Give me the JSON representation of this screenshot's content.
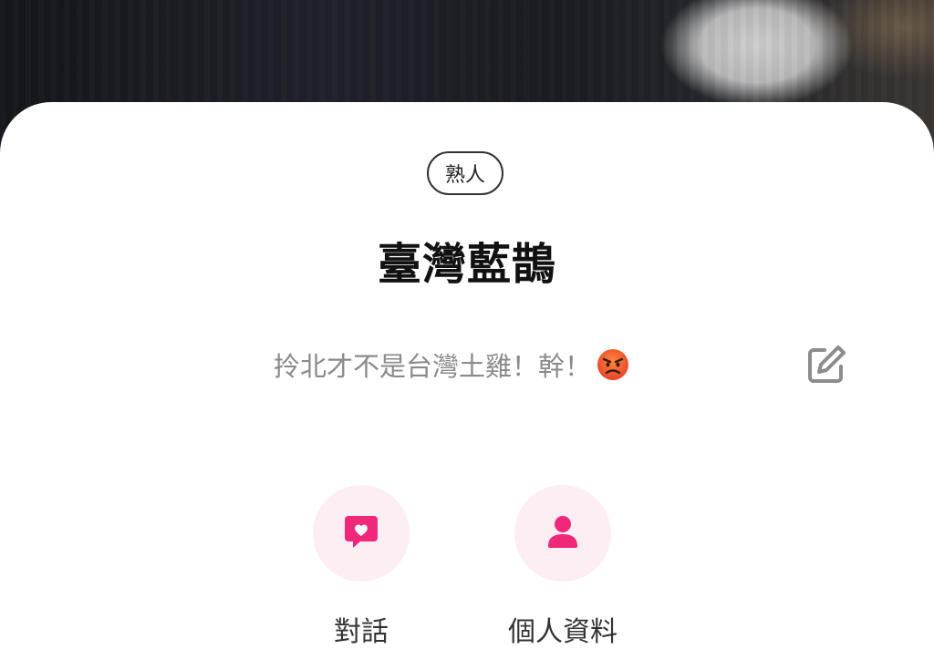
{
  "profile": {
    "relation_badge": "熟人",
    "name": "臺灣藍鵲",
    "status_text": "拎北才不是台灣土雞！幹！",
    "status_emoji": "angry-face-emoji"
  },
  "actions": [
    {
      "label": "對話",
      "icon": "chat-heart-icon"
    },
    {
      "label": "個人資料",
      "icon": "person-icon"
    }
  ],
  "edit_icon": "edit-icon",
  "colors": {
    "accent": "#f0287a",
    "action_bg": "#fdeef3",
    "status_text": "#8a8a8a",
    "name_text": "#111111"
  }
}
